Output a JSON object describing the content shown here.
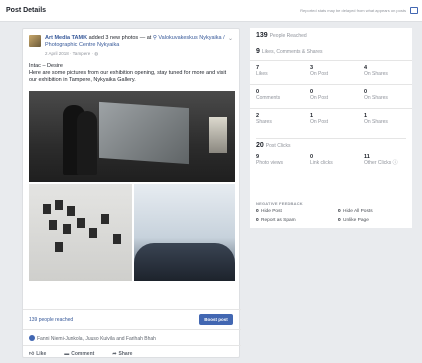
{
  "header": {
    "title": "Post Details",
    "note": "Reported stats may be delayed from what appears on posts"
  },
  "post": {
    "author": "Art Media TAMK",
    "action": "added 3 new photos",
    "at": "— at",
    "place": "Valokuvakeskus Nykyaika / Photographic Centre Nykyaika",
    "date": "2 April 2018 · Tampere ·",
    "body_line1": "Intac – Desire",
    "body_line2": "Here are some pictures from our exhibition opening, stay tuned for more and visit our exhibition in Tampere, Nykyaika Gallery.",
    "reach_text": "139 people reached",
    "boost_label": "Boost post",
    "reactions_text": "Fanni Niemi-Junkola, Juuso Kuivila and Farihah Bhah",
    "actions": {
      "like": "Like",
      "comment": "Comment",
      "share": "Share"
    }
  },
  "stats": {
    "reached_value": "139",
    "reached_label": "People Reached",
    "engage_value": "9",
    "engage_label": "Likes, Comments & Shares",
    "rows": [
      {
        "total": "7",
        "total_label": "Likes",
        "on_post": "3",
        "on_post_label": "On Post",
        "on_shares": "4",
        "on_shares_label": "On Shares"
      },
      {
        "total": "0",
        "total_label": "Comments",
        "on_post": "0",
        "on_post_label": "On Post",
        "on_shares": "0",
        "on_shares_label": "On Shares"
      },
      {
        "total": "2",
        "total_label": "Shares",
        "on_post": "1",
        "on_post_label": "On Post",
        "on_shares": "1",
        "on_shares_label": "On Shares"
      }
    ],
    "clicks_value": "20",
    "clicks_label": "Post Clicks",
    "clicks": [
      {
        "value": "9",
        "label": "Photo views"
      },
      {
        "value": "0",
        "label": "Link clicks"
      },
      {
        "value": "11",
        "label": "Other Clicks"
      }
    ],
    "negative_title": "NEGATIVE FEEDBACK",
    "negative": [
      {
        "value": "0",
        "label": "Hide Post"
      },
      {
        "value": "0",
        "label": "Hide All Posts"
      },
      {
        "value": "0",
        "label": "Report as Spam"
      },
      {
        "value": "0",
        "label": "Unlike Page"
      }
    ]
  }
}
